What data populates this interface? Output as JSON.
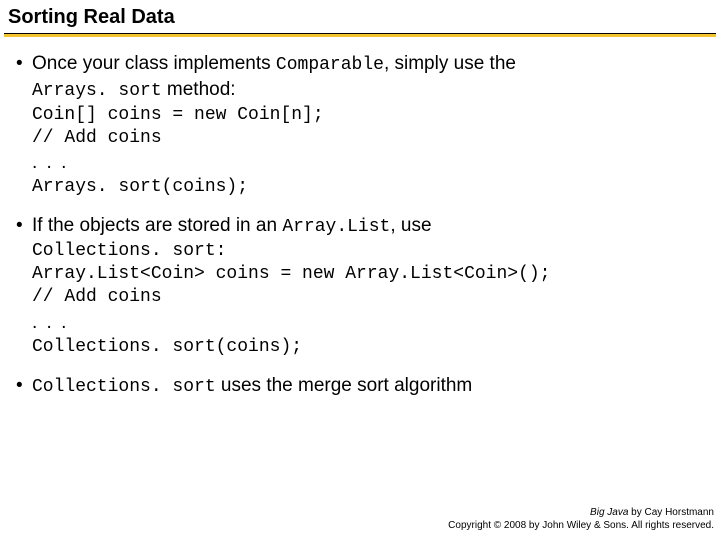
{
  "title": "Sorting Real Data",
  "bullets": {
    "b1": {
      "pre": "Once your class implements ",
      "code1": "Comparable",
      "mid": ", simply use the ",
      "code2": "Arrays. sort",
      "post": " method:"
    },
    "code1a": "Coin[] coins = new Coin[n];\n// Add coins",
    "dots1": ". . .",
    "code1b": "Arrays. sort(coins);",
    "b2": {
      "pre": "If the objects are stored in an ",
      "code1": "Array.List",
      "post": ", use"
    },
    "code2a": "Collections. sort:\nArray.List<Coin> coins = new Array.List<Coin>();\n// Add coins",
    "dots2": ". . .",
    "code2b": "Collections. sort(coins);",
    "b3": {
      "code1": "Collections. sort",
      "post": " uses the merge sort algorithm"
    }
  },
  "footer": {
    "book": "Big Java",
    "author": " by Cay Horstmann",
    "copyright": "Copyright © 2008 by John Wiley & Sons. All rights reserved."
  }
}
